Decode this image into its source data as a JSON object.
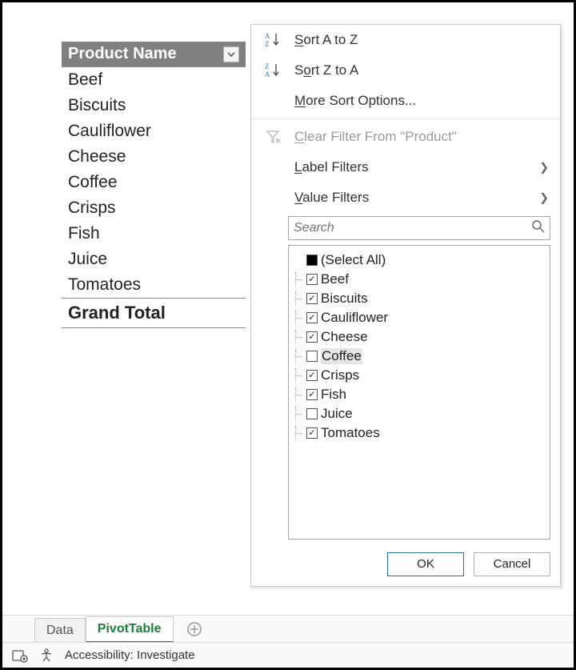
{
  "pivot": {
    "header": "Product Name",
    "rows": [
      "Beef",
      "Biscuits",
      "Cauliflower",
      "Cheese",
      "Coffee",
      "Crisps",
      "Fish",
      "Juice",
      "Tomatoes"
    ],
    "grand_total": "Grand Total"
  },
  "menu": {
    "sort_az": "Sort A to Z",
    "sort_za": "Sort Z to A",
    "more_sort": "More Sort Options...",
    "clear_filter": "Clear Filter From \"Product\"",
    "label_filters": "Label Filters",
    "value_filters": "Value Filters",
    "search_placeholder": "Search",
    "select_all": "(Select All)",
    "items": [
      {
        "label": "Beef",
        "checked": true,
        "highlight": false
      },
      {
        "label": "Biscuits",
        "checked": true,
        "highlight": false
      },
      {
        "label": "Cauliflower",
        "checked": true,
        "highlight": false
      },
      {
        "label": "Cheese",
        "checked": true,
        "highlight": false
      },
      {
        "label": "Coffee",
        "checked": false,
        "highlight": true
      },
      {
        "label": "Crisps",
        "checked": true,
        "highlight": false
      },
      {
        "label": "Fish",
        "checked": true,
        "highlight": false
      },
      {
        "label": "Juice",
        "checked": false,
        "highlight": false
      },
      {
        "label": "Tomatoes",
        "checked": true,
        "highlight": false
      }
    ],
    "ok": "OK",
    "cancel": "Cancel"
  },
  "tabs": {
    "data": "Data",
    "pivot": "PivotTable"
  },
  "status": {
    "accessibility": "Accessibility: Investigate"
  }
}
